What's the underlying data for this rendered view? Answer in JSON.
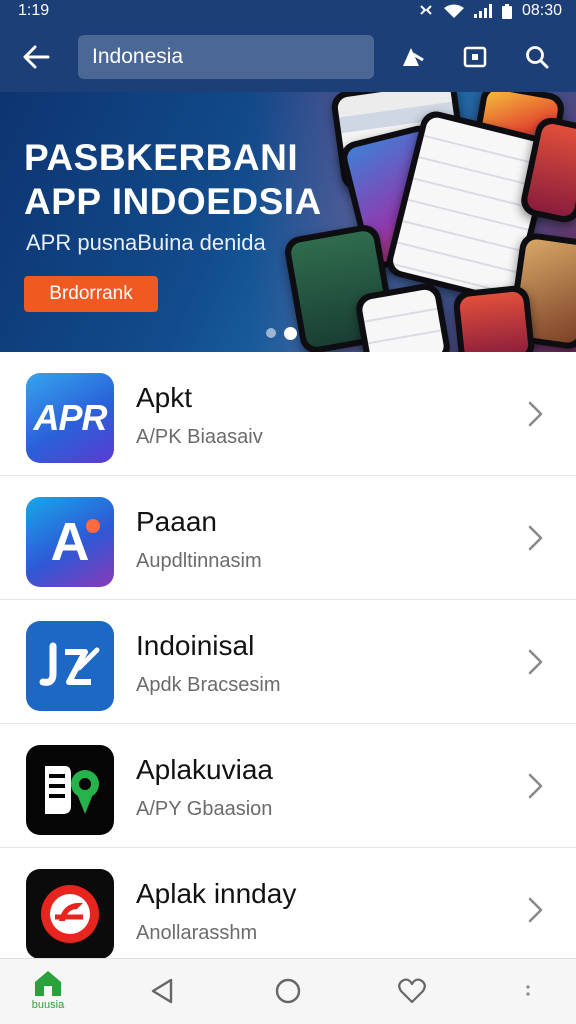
{
  "status_bar": {
    "time": "1:19",
    "clock_right": "08:30"
  },
  "search": {
    "query": "Indonesia"
  },
  "banner": {
    "title_line1": "PASBKERBANI",
    "title_line2": "APP INDOEDSIA",
    "subtitle": "APR pusnaBuina denida",
    "button_label": "Brdorrank",
    "page_count": 2,
    "active_page": 2
  },
  "apps": [
    {
      "title": "Apkt",
      "subtitle": "A/PK Biaasaiv",
      "icon_text": "APR"
    },
    {
      "title": "Paaan",
      "subtitle": "Aupdltinnasim",
      "icon_text": "A"
    },
    {
      "title": "Indoinisal",
      "subtitle": "Apdk Bracsesim"
    },
    {
      "title": "Aplakuviaa",
      "subtitle": "A/PY Gbaasion"
    },
    {
      "title": "Aplak innday",
      "subtitle": "Anollarasshm"
    }
  ],
  "bottom_nav": {
    "home_label": "buusia"
  },
  "colors": {
    "app_bar": "#1d3f78",
    "banner_button": "#f05a22",
    "home_active": "#2aa13a"
  },
  "icons": [
    "back-arrow-icon",
    "translate-icon",
    "scan-icon",
    "search-icon",
    "chevron-right-icon",
    "home-icon",
    "nav-back-icon",
    "nav-home-circle-icon",
    "heart-icon",
    "more-icon"
  ]
}
